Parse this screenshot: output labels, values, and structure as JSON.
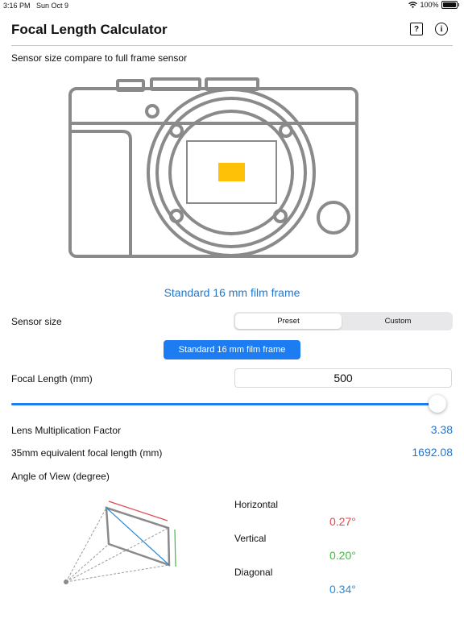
{
  "status_bar": {
    "time": "3:16 PM",
    "date": "Sun Oct 9",
    "battery": "100%"
  },
  "header": {
    "title": "Focal Length Calculator",
    "help_icon": "question-square-icon",
    "info_icon": "info-circle-icon"
  },
  "sensor_compare": {
    "caption": "Sensor size compare to full frame sensor",
    "sensor_color": "#ffc107"
  },
  "frame_link": "Standard 16 mm film frame",
  "sensor_size": {
    "label": "Sensor size",
    "segments": [
      "Preset",
      "Custom"
    ],
    "selected_segment": "Preset",
    "preset_button": "Standard 16 mm film frame"
  },
  "focal_length": {
    "label": "Focal Length (mm)",
    "value": "500",
    "slider_fraction": 1.0
  },
  "results": {
    "multiplier_label": "Lens Multiplication Factor",
    "multiplier_value": "3.38",
    "equivalent_label": "35mm equivalent focal length (mm)",
    "equivalent_value": "1692.08"
  },
  "angle_of_view": {
    "label": "Angle of View (degree)",
    "horizontal_label": "Horizontal",
    "horizontal_value": "0.27°",
    "horizontal_color": "#e0484d",
    "vertical_label": "Vertical",
    "vertical_value": "0.20°",
    "vertical_color": "#3cc03c",
    "diagonal_label": "Diagonal",
    "diagonal_value": "0.34°",
    "diagonal_color": "#2a8ad6"
  },
  "colors": {
    "accent": "#1e7cf2",
    "link": "#1f77d3"
  }
}
